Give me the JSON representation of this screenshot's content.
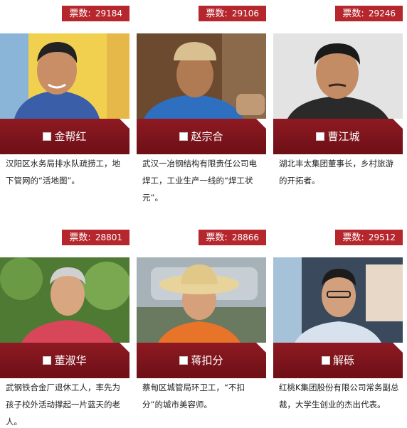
{
  "vote_label": "票数:",
  "cards": [
    {
      "votes": "29184",
      "name": "金帮红",
      "desc": "汉阳区水务局排水队疏捞工，地下管网的“活地图”。",
      "photo_bg": "#e8c64a"
    },
    {
      "votes": "29106",
      "name": "赵宗合",
      "desc": "武汉一冶钢结构有限责任公司电焊工，工业生产一线的“焊工状元”。",
      "photo_bg": "#7a5a3a"
    },
    {
      "votes": "29246",
      "name": "曹江城",
      "desc": "湖北丰太集团董事长，乡村旅游的开拓者。",
      "photo_bg": "#d9d9d9"
    },
    {
      "votes": "28801",
      "name": "董淑华",
      "desc": "武钢铁合金厂退休工人，率先为孩子校外活动撑起一片蓝天的老人。",
      "photo_bg": "#5f8a3e"
    },
    {
      "votes": "28866",
      "name": "蒋扣分",
      "desc": "蔡甸区城管局环卫工，“不扣分”的城市美容师。",
      "photo_bg": "#9aa6ad"
    },
    {
      "votes": "29512",
      "name": "解砾",
      "desc": "红桃K集团股份有限公司常务副总裁，大学生创业的杰出代表。",
      "photo_bg": "#3a4a5a"
    }
  ],
  "colors": {
    "badge": "#b5272d",
    "namebar": "#7a1219"
  }
}
